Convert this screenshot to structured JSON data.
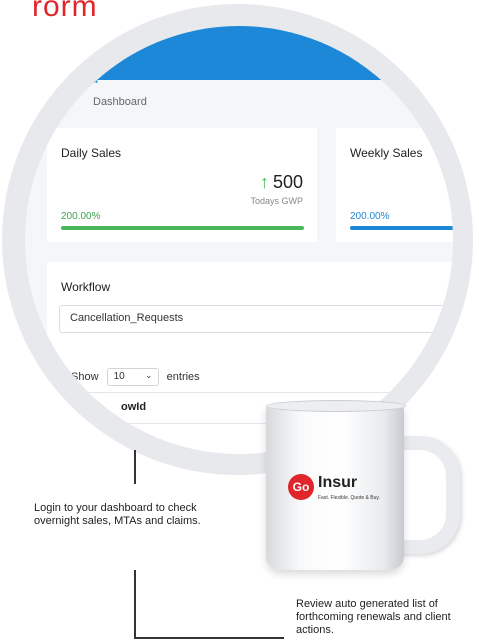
{
  "header_fragment": "rorm",
  "dashboard": {
    "title_fragment": ".d",
    "breadcrumb": "Dashboard"
  },
  "cards": {
    "daily": {
      "label": "Daily Sales",
      "value": "500",
      "subtitle": "Todays GWP",
      "percent": "200.00%",
      "bar_color": "#48b85a"
    },
    "weekly": {
      "label": "Weekly Sales",
      "percent": "200.00%",
      "bar_color": "#1d88d8"
    }
  },
  "workflow": {
    "label": "Workflow",
    "selected": "Cancellation_Requests",
    "show_label": "Show",
    "entries_value": "10",
    "entries_label": "entries",
    "table_header_fragment": "owId"
  },
  "captions": {
    "left": "Login to your dashboard to check overnight sales, MTAs and claims.",
    "right": "Review auto generated list of forthcoming renewals and client actions."
  },
  "mug": {
    "logo_badge": "Go",
    "logo_word": "Insur",
    "logo_tagline": "Fast. Flexible. Quote & Buy."
  },
  "colors": {
    "brand_red": "#e0262b",
    "brand_blue": "#1d88d8"
  }
}
